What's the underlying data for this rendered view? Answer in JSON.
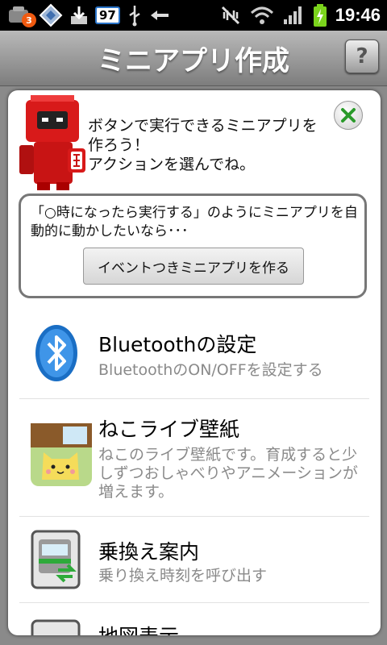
{
  "status_bar": {
    "notification_badge": "3",
    "badge_number": "97",
    "time": "19:46"
  },
  "header": {
    "title": "ミニアプリ作成",
    "help_label": "?"
  },
  "dialog": {
    "intro_text": "ボタンで実行できるミニアプリを作ろう！\nアクションを選んでね。",
    "event_text": "「○時になったら実行する」のようにミニアプリを自動的に動かしたいなら･･･",
    "event_button": "イベントつきミニアプリを作る",
    "actions": [
      {
        "title": "Bluetoothの設定",
        "desc": "BluetoothのON/OFFを設定する",
        "icon": "bluetooth-icon"
      },
      {
        "title": "ねこライブ壁紙",
        "desc": "ねこのライブ壁紙です。育成すると少しずつおしゃべりやアニメーションが増えます。",
        "icon": "cat-wallpaper-icon"
      },
      {
        "title": "乗換え案内",
        "desc": "乗り換え時刻を呼び出す",
        "icon": "train-transfer-icon"
      },
      {
        "title": "地図表示",
        "desc": "",
        "icon": "map-icon"
      }
    ]
  }
}
